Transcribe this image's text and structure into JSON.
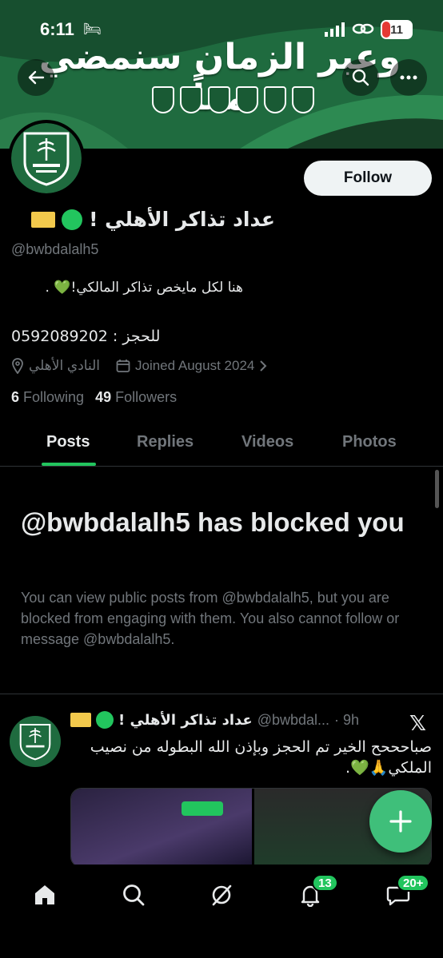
{
  "status_bar": {
    "time": "6:11",
    "battery": "11"
  },
  "banner": {
    "title": "وعبر الزمان سنمضي معاً"
  },
  "profile": {
    "display_name": "عداد تذاكر الأهلي !",
    "handle": "@bwbdalalh5",
    "bio_line1": "هنا لكل مايخص تذاكر المالكي!💚 .",
    "bio_line2": "للحجز : 0592089202",
    "location": "النادي الأهلي",
    "joined": "Joined August 2024",
    "following_count": "6",
    "following_label": "Following",
    "followers_count": "49",
    "followers_label": "Followers"
  },
  "actions": {
    "follow_label": "Follow"
  },
  "tabs": [
    "Posts",
    "Replies",
    "Videos",
    "Photos"
  ],
  "blocked": {
    "title": "@bwbdalalh5 has blocked you",
    "text": "You can view public posts from @bwbdalalh5, but you are blocked from engaging with them. You also cannot follow or message @bwbdalalh5."
  },
  "post": {
    "author_name": "عداد تذاكر الأهلي !",
    "author_handle": "@bwbdal...",
    "time": "· 9h",
    "text": "صباحححح الخير تم الحجز وبإذن الله البطوله من نصيب الملكي🙏💚."
  },
  "bottom_nav": {
    "notifications_badge": "13",
    "messages_badge": "20+"
  },
  "colors": {
    "accent": "#22c55e",
    "banner": "#1f6b3f",
    "background": "#000000",
    "muted": "#71767b"
  }
}
